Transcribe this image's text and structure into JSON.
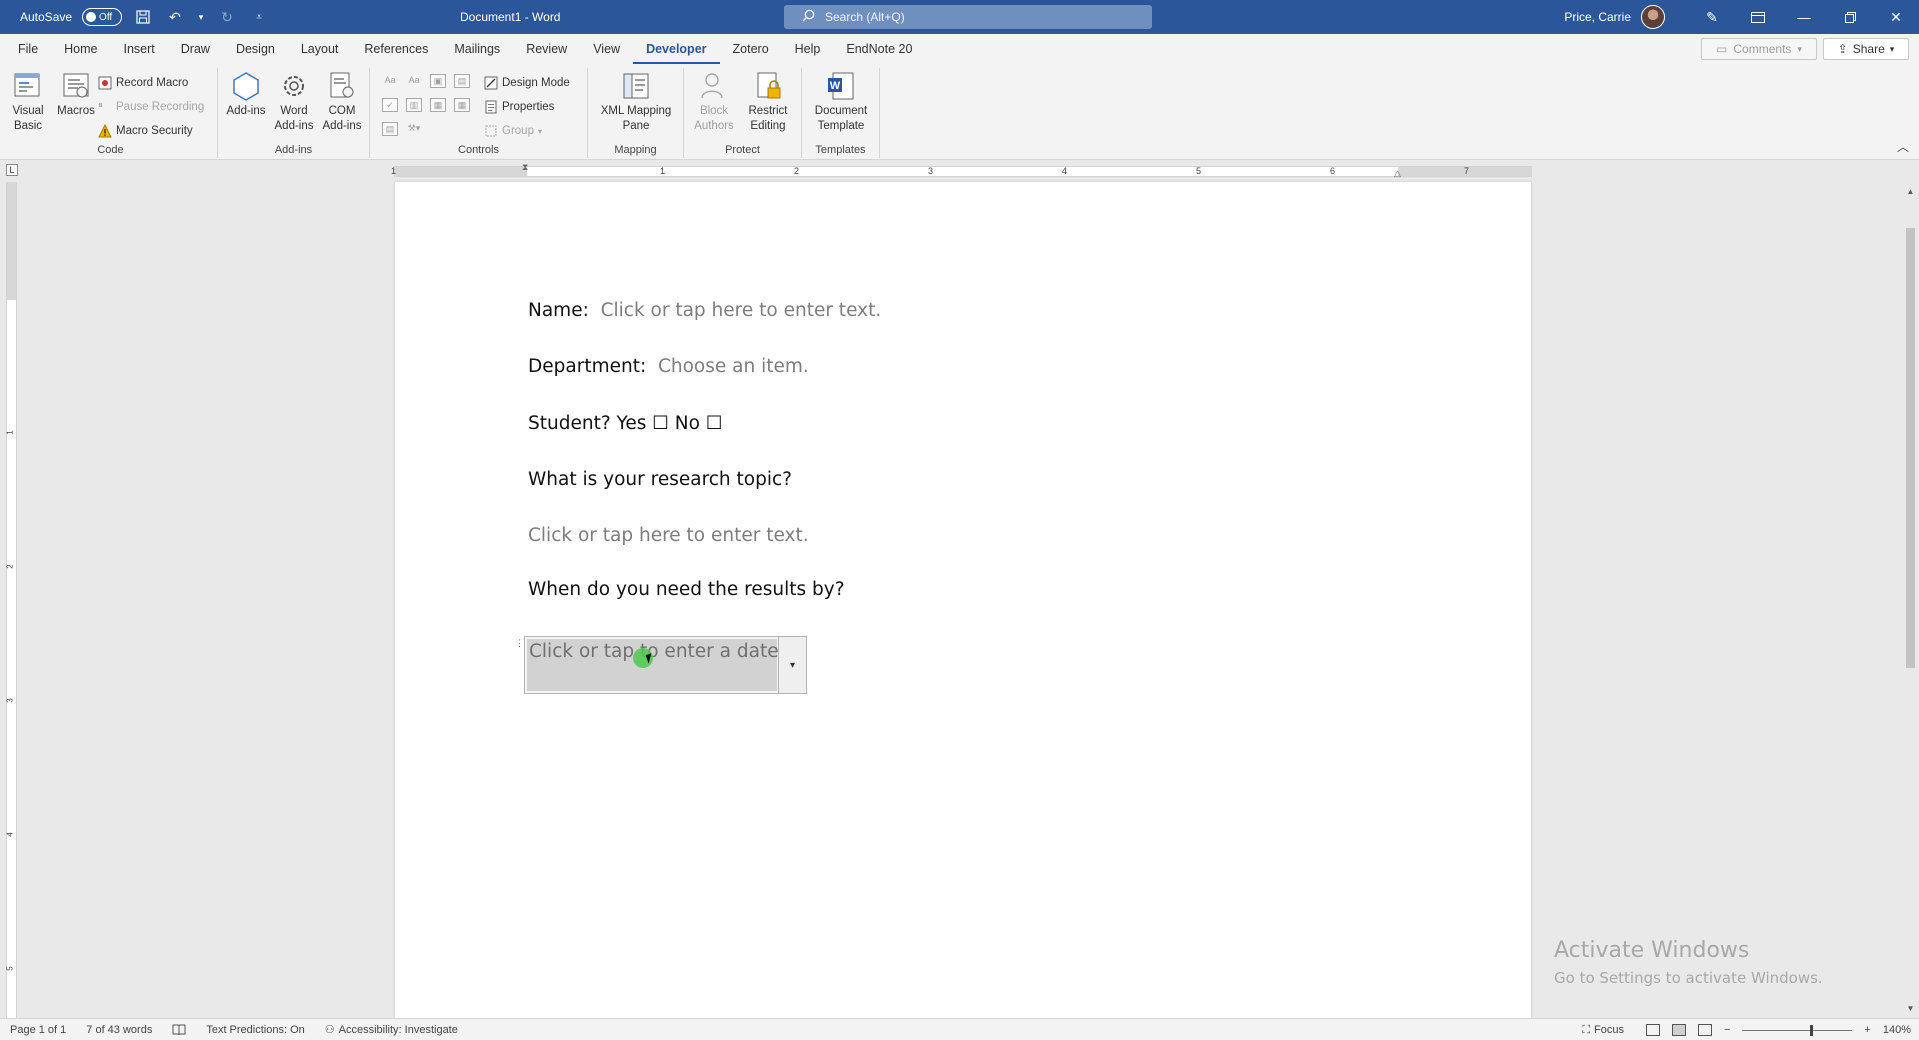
{
  "titlebar": {
    "autosave_label": "AutoSave",
    "autosave_state": "Off",
    "doc_title": "Document1 - Word",
    "search_placeholder": "Search (Alt+Q)",
    "user_name": "Price, Carrie"
  },
  "menu": {
    "tabs": [
      "File",
      "Home",
      "Insert",
      "Draw",
      "Design",
      "Layout",
      "References",
      "Mailings",
      "Review",
      "View",
      "Developer",
      "Zotero",
      "Help",
      "EndNote 20"
    ],
    "active_tab": "Developer",
    "comments_label": "Comments",
    "share_label": "Share"
  },
  "ribbon": {
    "code": {
      "label": "Code",
      "visual_basic": "Visual Basic",
      "macros": "Macros",
      "record_macro": "Record Macro",
      "pause_recording": "Pause Recording",
      "macro_security": "Macro Security"
    },
    "addins": {
      "label": "Add-ins",
      "add_ins": "Add-ins",
      "word_add_ins": "Word Add-ins",
      "com_add_ins": "COM Add-ins"
    },
    "controls": {
      "label": "Controls",
      "design_mode": "Design Mode",
      "properties": "Properties",
      "group": "Group"
    },
    "mapping": {
      "label": "Mapping",
      "xml_mapping_pane": "XML Mapping Pane"
    },
    "protect": {
      "label": "Protect",
      "block_authors": "Block Authors",
      "restrict_editing": "Restrict Editing"
    },
    "templates": {
      "label": "Templates",
      "document_template": "Document Template"
    }
  },
  "ruler": {
    "numbers": [
      "1",
      "1",
      "2",
      "3",
      "4",
      "5",
      "6",
      "7"
    ],
    "vnumbers": [
      "1",
      "2",
      "3",
      "4",
      "5"
    ]
  },
  "document": {
    "name_label": "Name:",
    "name_placeholder": "Click or tap here to enter text.",
    "department_label": "Department:",
    "department_placeholder": "Choose an item.",
    "student_label": "Student? Yes",
    "yes_box": "☐",
    "no_label": "No",
    "no_box": "☐",
    "research_question": "What is your research topic?",
    "research_placeholder": "Click or tap here to enter text.",
    "date_question": "When do you need the results by?",
    "date_placeholder": "Click or tap to enter a date."
  },
  "watermark": {
    "line1": "Activate Windows",
    "line2": "Go to Settings to activate Windows."
  },
  "status": {
    "page": "Page 1 of 1",
    "words": "7 of 43 words",
    "text_predictions": "Text Predictions: On",
    "accessibility": "Accessibility: Investigate",
    "focus": "Focus",
    "zoom": "140%"
  }
}
